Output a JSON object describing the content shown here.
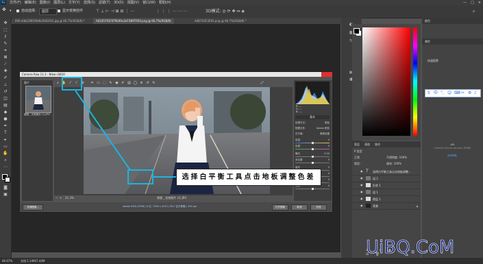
{
  "menubar": {
    "logo": "Ps",
    "menus": [
      "文件(F)",
      "编辑(E)",
      "图像(I)",
      "图层(L)",
      "文字(Y)",
      "选择(S)",
      "滤镜(T)",
      "3D(D)",
      "视图(V)",
      "窗口(W)",
      "帮助(H)"
    ],
    "window_controls": [
      "—",
      "□",
      "✕"
    ]
  },
  "optionsbar": {
    "auto_select_label": "自动选择：",
    "auto_select_value": "图层",
    "show_transform_label": "显示变换控件"
  },
  "tabs": [
    {
      "label": "699 d4b23f81f9d6e5662f43.jpg @ 66.7%(RGB/8) *",
      "active": false
    },
    {
      "label": "A0245791F0T9k9Au3eT4B9T950.png @ 66.7%(RGB/8)",
      "active": true
    },
    {
      "label": "A0B7D3F2E91.png @ 66.7%(RGB/8) *",
      "active": false
    }
  ],
  "camera_raw": {
    "title": "Camera Raw 11.3 - Nikon D810",
    "filmstrip_label": "胶片",
    "thumb_caption": "原图 _ 初拍照片 (1).JPG",
    "preview_bottom_zoom": "21.3%",
    "preview_bottom_file": "原图 _ 初拍照片 (1).JPG",
    "histogram_readout": [
      "R:  ---",
      "G:  ---",
      "B:  ---"
    ],
    "panel_title": "基本",
    "panel_rows": [
      {
        "label": "处理方式：",
        "value": "颜色"
      },
      {
        "label": "配置文件：",
        "value": "Adobe 颜色"
      },
      {
        "label": "白平衡：",
        "value": "原照设置"
      },
      {
        "label": "色温",
        "value": "0"
      },
      {
        "label": "色调",
        "value": "0"
      },
      {
        "label": "曝光",
        "value": "0.00"
      },
      {
        "label": "对比度",
        "value": "0"
      },
      {
        "label": "高光",
        "value": "0"
      },
      {
        "label": "阴影",
        "value": "0"
      },
      {
        "label": "白色",
        "value": "0"
      },
      {
        "label": "黑色",
        "value": "0"
      }
    ],
    "footer_info": "Adobe RGB (1998); 8 位; 7360 x 4912 (36.2 百万像素); 300 ppi",
    "footer_left_button": "存储图像...",
    "footer_buttons": [
      "打开图像",
      "取消",
      "完成"
    ]
  },
  "callout": {
    "text": "选择白平衡工具点击地板调整色差",
    "color": "#1cb4de"
  },
  "right_dock": {
    "icons": [
      "color-icon",
      "swatches-icon",
      "history-icon",
      "properties-icon"
    ],
    "labels": [
      "属性",
      "调整"
    ]
  },
  "panel2": {
    "header1": "颜色",
    "header2": "属性",
    "subheader": "快速报警"
  },
  "ime": {
    "items": [
      "中",
      "°,",
      "☺",
      "⌨",
      "✂",
      "⚙",
      "♪"
    ]
  },
  "cc_libraries": {
    "title": "Creative Cloud Libraries 不可用",
    "link": "请求帮助"
  },
  "layers": {
    "tabs": [
      "图层",
      "通道",
      "路径"
    ],
    "kind_label": "P 类型",
    "mode": "正常",
    "opacity_label": "不透明度: 100%",
    "lock_label": "锁定:",
    "fill_label": "填充: 100%",
    "rows": [
      {
        "name": "选择白平衡工具点击地板调整..."
      },
      {
        "name": "组 2"
      },
      {
        "name": "形状 1"
      },
      {
        "name": "组 1"
      },
      {
        "name": "图层 1"
      },
      {
        "name": "背景"
      }
    ]
  },
  "statusbar": {
    "zoom": "66.67%",
    "doc": "文档:1.24M/7.44M"
  },
  "watermark": {
    "text": "UiBQ.CoM"
  }
}
